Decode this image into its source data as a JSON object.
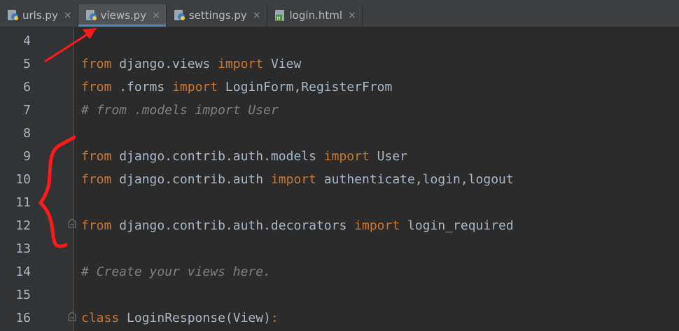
{
  "tabs": [
    {
      "label": "urls.py",
      "close": "×",
      "icon": "python-file-icon"
    },
    {
      "label": "views.py",
      "close": "×",
      "icon": "python-file-icon",
      "active": true
    },
    {
      "label": "settings.py",
      "close": "×",
      "icon": "python-file-icon"
    },
    {
      "label": "login.html",
      "close": "×",
      "icon": "html-file-icon"
    }
  ],
  "colors": {
    "keyword": "#cc7832",
    "text": "#a9b7c6",
    "comment": "#808080",
    "background": "#2b2b2b",
    "gutter": "#313335",
    "annotation": "#ff1a1a"
  },
  "lines": [
    {
      "num": "4",
      "segments": []
    },
    {
      "num": "5",
      "segments": [
        {
          "t": "from",
          "k": "kw"
        },
        {
          "t": " django.views ",
          "k": "tx"
        },
        {
          "t": "import",
          "k": "kw"
        },
        {
          "t": " View",
          "k": "tx"
        }
      ]
    },
    {
      "num": "6",
      "segments": [
        {
          "t": "from",
          "k": "kw"
        },
        {
          "t": " .forms ",
          "k": "tx"
        },
        {
          "t": "import",
          "k": "kw"
        },
        {
          "t": " LoginForm,RegisterFrom",
          "k": "tx"
        }
      ]
    },
    {
      "num": "7",
      "segments": [
        {
          "t": "# from .models import User",
          "k": "cm"
        }
      ]
    },
    {
      "num": "8",
      "segments": []
    },
    {
      "num": "9",
      "segments": [
        {
          "t": "from",
          "k": "kw"
        },
        {
          "t": " django.contrib.auth.models ",
          "k": "tx"
        },
        {
          "t": "import",
          "k": "kw"
        },
        {
          "t": " User",
          "k": "tx"
        }
      ]
    },
    {
      "num": "10",
      "segments": [
        {
          "t": "from",
          "k": "kw"
        },
        {
          "t": " django.contrib.auth ",
          "k": "tx"
        },
        {
          "t": "import",
          "k": "kw"
        },
        {
          "t": " authenticate,login,logout",
          "k": "tx"
        }
      ]
    },
    {
      "num": "11",
      "segments": []
    },
    {
      "num": "12",
      "segments": [
        {
          "t": "from",
          "k": "kw"
        },
        {
          "t": " django.contrib.auth.decorators ",
          "k": "tx"
        },
        {
          "t": "import",
          "k": "kw"
        },
        {
          "t": " login_required",
          "k": "tx"
        }
      ]
    },
    {
      "num": "13",
      "segments": []
    },
    {
      "num": "14",
      "segments": [
        {
          "t": "# Create your views here.",
          "k": "cm"
        }
      ]
    },
    {
      "num": "15",
      "segments": []
    },
    {
      "num": "16",
      "segments": [
        {
          "t": "class",
          "k": "kw"
        },
        {
          "t": " LoginResponse(View)",
          "k": "tx"
        },
        {
          "t": ":",
          "k": "kw"
        }
      ]
    }
  ]
}
